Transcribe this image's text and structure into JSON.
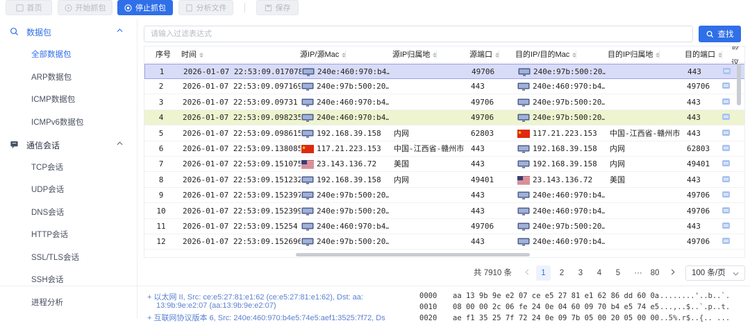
{
  "toolbar": {
    "home": "首页",
    "start": "开始抓包",
    "stop": "停止抓包",
    "analyze": "分析文件",
    "save": "保存"
  },
  "sidebar": {
    "group_packets": "数据包",
    "packets": [
      "全部数据包",
      "ARP数据包",
      "ICMP数据包",
      "ICMPv6数据包"
    ],
    "group_sessions": "通信会话",
    "sessions": [
      "TCP会话",
      "UDP会话",
      "DNS会话",
      "HTTP会话",
      "SSL/TLS会话",
      "SSH会话",
      "进程分析"
    ]
  },
  "filter": {
    "placeholder": "请输入过滤表达式",
    "search": "查找"
  },
  "columns": [
    "序号",
    "时间",
    "源IP/源Mac",
    "源IP归属地",
    "源端口",
    "目的IP/目的Mac",
    "目的IP归属地",
    "目的端口",
    "协议"
  ],
  "rows": [
    {
      "no": "1",
      "time": "2026-01-07 22:53:09.017078",
      "sicon": "monitor",
      "src": "240e:460:970:b4…",
      "sloc": "",
      "sport": "49706",
      "dicon": "monitor",
      "dst": "240e:97b:500:20…",
      "dloc": "",
      "dport": "443"
    },
    {
      "no": "2",
      "time": "2026-01-07 22:53:09.097169",
      "sicon": "monitor",
      "src": "240e:97b:500:20…",
      "sloc": "",
      "sport": "443",
      "dicon": "monitor",
      "dst": "240e:460:970:b4…",
      "dloc": "",
      "dport": "49706"
    },
    {
      "no": "3",
      "time": "2026-01-07 22:53:09.09731",
      "sicon": "monitor",
      "src": "240e:460:970:b4…",
      "sloc": "",
      "sport": "49706",
      "dicon": "monitor",
      "dst": "240e:97b:500:20…",
      "dloc": "",
      "dport": "443"
    },
    {
      "no": "4",
      "time": "2026-01-07 22:53:09.098235",
      "sicon": "monitor",
      "src": "240e:460:970:b4…",
      "sloc": "",
      "sport": "49706",
      "dicon": "monitor",
      "dst": "240e:97b:500:20…",
      "dloc": "",
      "dport": "443"
    },
    {
      "no": "5",
      "time": "2026-01-07 22:53:09.098615",
      "sicon": "monitor",
      "src": "192.168.39.158",
      "sloc": "内网",
      "sport": "62803",
      "dicon": "flag-cn",
      "dst": "117.21.223.153",
      "dloc": "中国-江西省-赣州市",
      "dport": "443"
    },
    {
      "no": "6",
      "time": "2026-01-07 22:53:09.138085",
      "sicon": "flag-cn",
      "src": "117.21.223.153",
      "sloc": "中国-江西省-赣州市",
      "sport": "443",
      "dicon": "monitor",
      "dst": "192.168.39.158",
      "dloc": "内网",
      "dport": "62803"
    },
    {
      "no": "7",
      "time": "2026-01-07 22:53:09.151075",
      "sicon": "flag-us",
      "src": "23.143.136.72",
      "sloc": "美国",
      "sport": "443",
      "dicon": "monitor",
      "dst": "192.168.39.158",
      "dloc": "内网",
      "dport": "49401"
    },
    {
      "no": "8",
      "time": "2026-01-07 22:53:09.151232",
      "sicon": "monitor",
      "src": "192.168.39.158",
      "sloc": "内网",
      "sport": "49401",
      "dicon": "flag-us",
      "dst": "23.143.136.72",
      "dloc": "美国",
      "dport": "443"
    },
    {
      "no": "9",
      "time": "2026-01-07 22:53:09.152397",
      "sicon": "monitor",
      "src": "240e:97b:500:20…",
      "sloc": "",
      "sport": "443",
      "dicon": "monitor",
      "dst": "240e:460:970:b4…",
      "dloc": "",
      "dport": "49706"
    },
    {
      "no": "10",
      "time": "2026-01-07 22:53:09.152399",
      "sicon": "monitor",
      "src": "240e:97b:500:20…",
      "sloc": "",
      "sport": "443",
      "dicon": "monitor",
      "dst": "240e:460:970:b4…",
      "dloc": "",
      "dport": "49706"
    },
    {
      "no": "11",
      "time": "2026-01-07 22:53:09.15254",
      "sicon": "monitor",
      "src": "240e:460:970:b4…",
      "sloc": "",
      "sport": "49706",
      "dicon": "monitor",
      "dst": "240e:97b:500:20…",
      "dloc": "",
      "dport": "443"
    },
    {
      "no": "12",
      "time": "2026-01-07 22:53:09.152696",
      "sicon": "monitor",
      "src": "240e:97b:500:20…",
      "sloc": "",
      "sport": "443",
      "dicon": "monitor",
      "dst": "240e:460:970:b4…",
      "dloc": "",
      "dport": "49706"
    }
  ],
  "pagination": {
    "total": "共 7910 条",
    "pages": [
      "1",
      "2",
      "3",
      "4",
      "5",
      "···",
      "80"
    ],
    "current": "1",
    "page_size": "100 条/页"
  },
  "detail": {
    "tree": [
      "以太网 II, Src: ce:e5:27:81:e1:62 (ce:e5:27:81:e1:62), Dst: aa:",
      "13:9b:9e:e2:07 (aa:13:9b:9e:e2:07)",
      "互联网协议版本 6, Src: 240e:460:970:b4e5:74e5:aef1:3525:7f72, Ds"
    ],
    "hex_offsets": [
      "0000",
      "0010",
      "0020"
    ],
    "hex_bytes": [
      "aa 13 9b 9e e2 07 ce e5 27 81 e1 62 86 dd 60 0a",
      "08 00 00 2c 06 fe 24 0e 04 60 09 70 b4 e5 74 e5",
      "ae f1 35 25 7f 72 24 0e 09 7b 05 00 20 05 00 00"
    ],
    "hex_ascii": [
      "........'..b..`.",
      "...,..$..`.p..t.",
      "..5%.r$..{.. ..."
    ]
  },
  "colors": {
    "accent": "#2f6fe8",
    "selected_row": "#d9dcf7",
    "highlight_row": "#eef4cf"
  }
}
